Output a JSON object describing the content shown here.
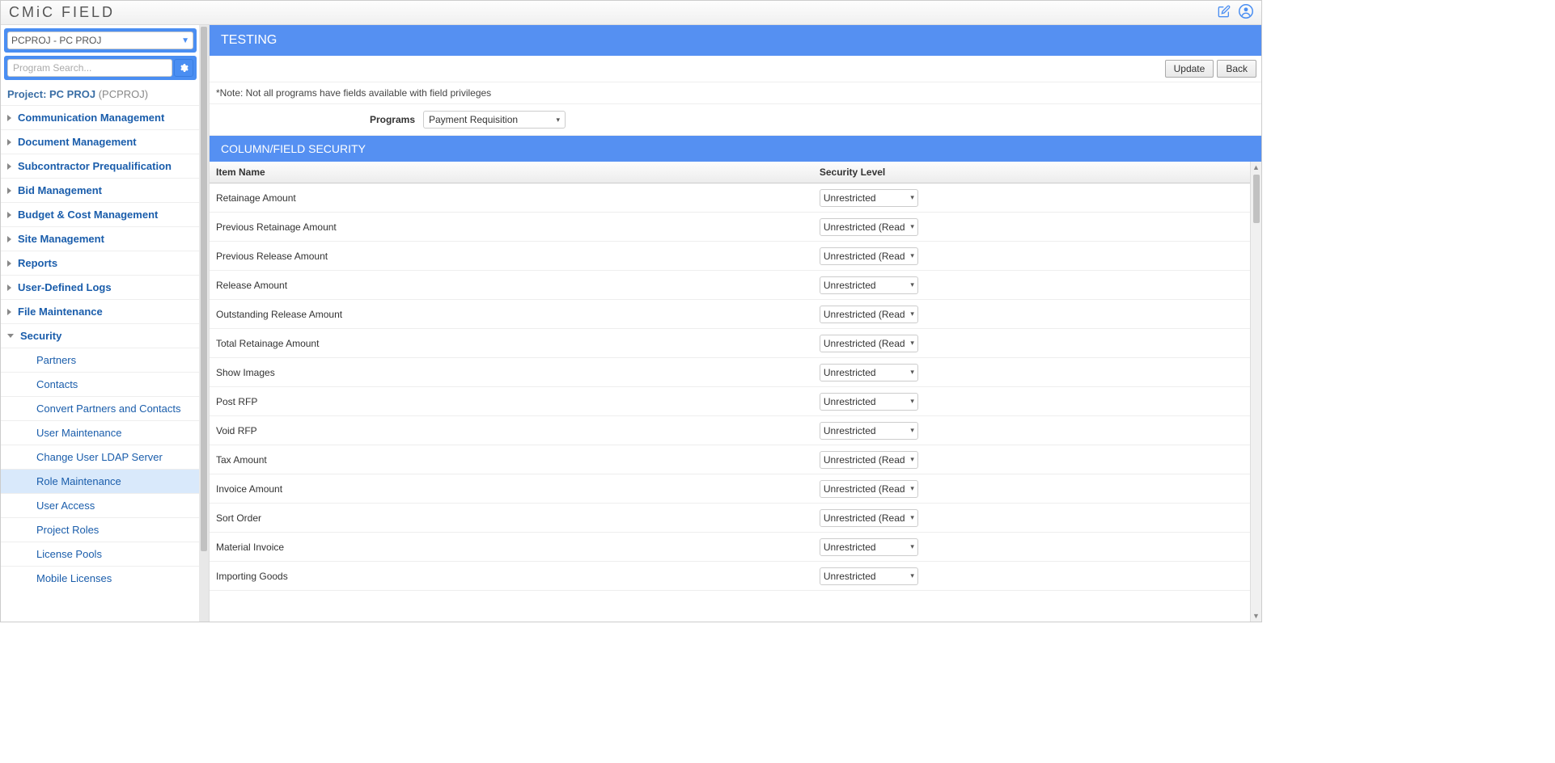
{
  "header": {
    "logo": "CMiC FIELD"
  },
  "sidebar": {
    "project_select": "PCPROJ - PC PROJ",
    "search_placeholder": "Program Search...",
    "project_label_prefix": "Project: ",
    "project_name": "PC PROJ",
    "project_code": "(PCPROJ)",
    "groups": [
      {
        "label": "Communication Management",
        "expanded": false
      },
      {
        "label": "Document Management",
        "expanded": false
      },
      {
        "label": "Subcontractor Prequalification",
        "expanded": false
      },
      {
        "label": "Bid Management",
        "expanded": false
      },
      {
        "label": "Budget & Cost Management",
        "expanded": false
      },
      {
        "label": "Site Management",
        "expanded": false
      },
      {
        "label": "Reports",
        "expanded": false
      },
      {
        "label": "User-Defined Logs",
        "expanded": false
      },
      {
        "label": "File Maintenance",
        "expanded": false
      },
      {
        "label": "Security",
        "expanded": true
      }
    ],
    "security_children": [
      {
        "label": "Partners",
        "active": false
      },
      {
        "label": "Contacts",
        "active": false
      },
      {
        "label": "Convert Partners and Contacts",
        "active": false
      },
      {
        "label": "User Maintenance",
        "active": false
      },
      {
        "label": "Change User LDAP Server",
        "active": false
      },
      {
        "label": "Role Maintenance",
        "active": true
      },
      {
        "label": "User Access",
        "active": false
      },
      {
        "label": "Project Roles",
        "active": false
      },
      {
        "label": "License Pools",
        "active": false
      },
      {
        "label": "Mobile Licenses",
        "active": false
      }
    ]
  },
  "main": {
    "banner": "TESTING",
    "buttons": {
      "update": "Update",
      "back": "Back"
    },
    "note": "*Note: Not all programs have fields available with field privileges",
    "programs_label": "Programs",
    "programs_value": "Payment Requisition",
    "section_header": "COLUMN/FIELD SECURITY",
    "columns": {
      "item": "Item Name",
      "level": "Security Level"
    },
    "rows": [
      {
        "item": "Retainage Amount",
        "level": "Unrestricted"
      },
      {
        "item": "Previous Retainage Amount",
        "level": "Unrestricted (Read-Only)"
      },
      {
        "item": "Previous Release Amount",
        "level": "Unrestricted (Read-Only)"
      },
      {
        "item": "Release Amount",
        "level": "Unrestricted"
      },
      {
        "item": "Outstanding Release Amount",
        "level": "Unrestricted (Read-Only)"
      },
      {
        "item": "Total Retainage Amount",
        "level": "Unrestricted (Read-Only)"
      },
      {
        "item": "Show Images",
        "level": "Unrestricted"
      },
      {
        "item": "Post RFP",
        "level": "Unrestricted"
      },
      {
        "item": "Void RFP",
        "level": "Unrestricted"
      },
      {
        "item": "Tax Amount",
        "level": "Unrestricted (Read-Only)"
      },
      {
        "item": "Invoice Amount",
        "level": "Unrestricted (Read-Only)"
      },
      {
        "item": "Sort Order",
        "level": "Unrestricted (Read-Only)"
      },
      {
        "item": "Material Invoice",
        "level": "Unrestricted"
      },
      {
        "item": "Importing Goods",
        "level": "Unrestricted"
      }
    ]
  }
}
